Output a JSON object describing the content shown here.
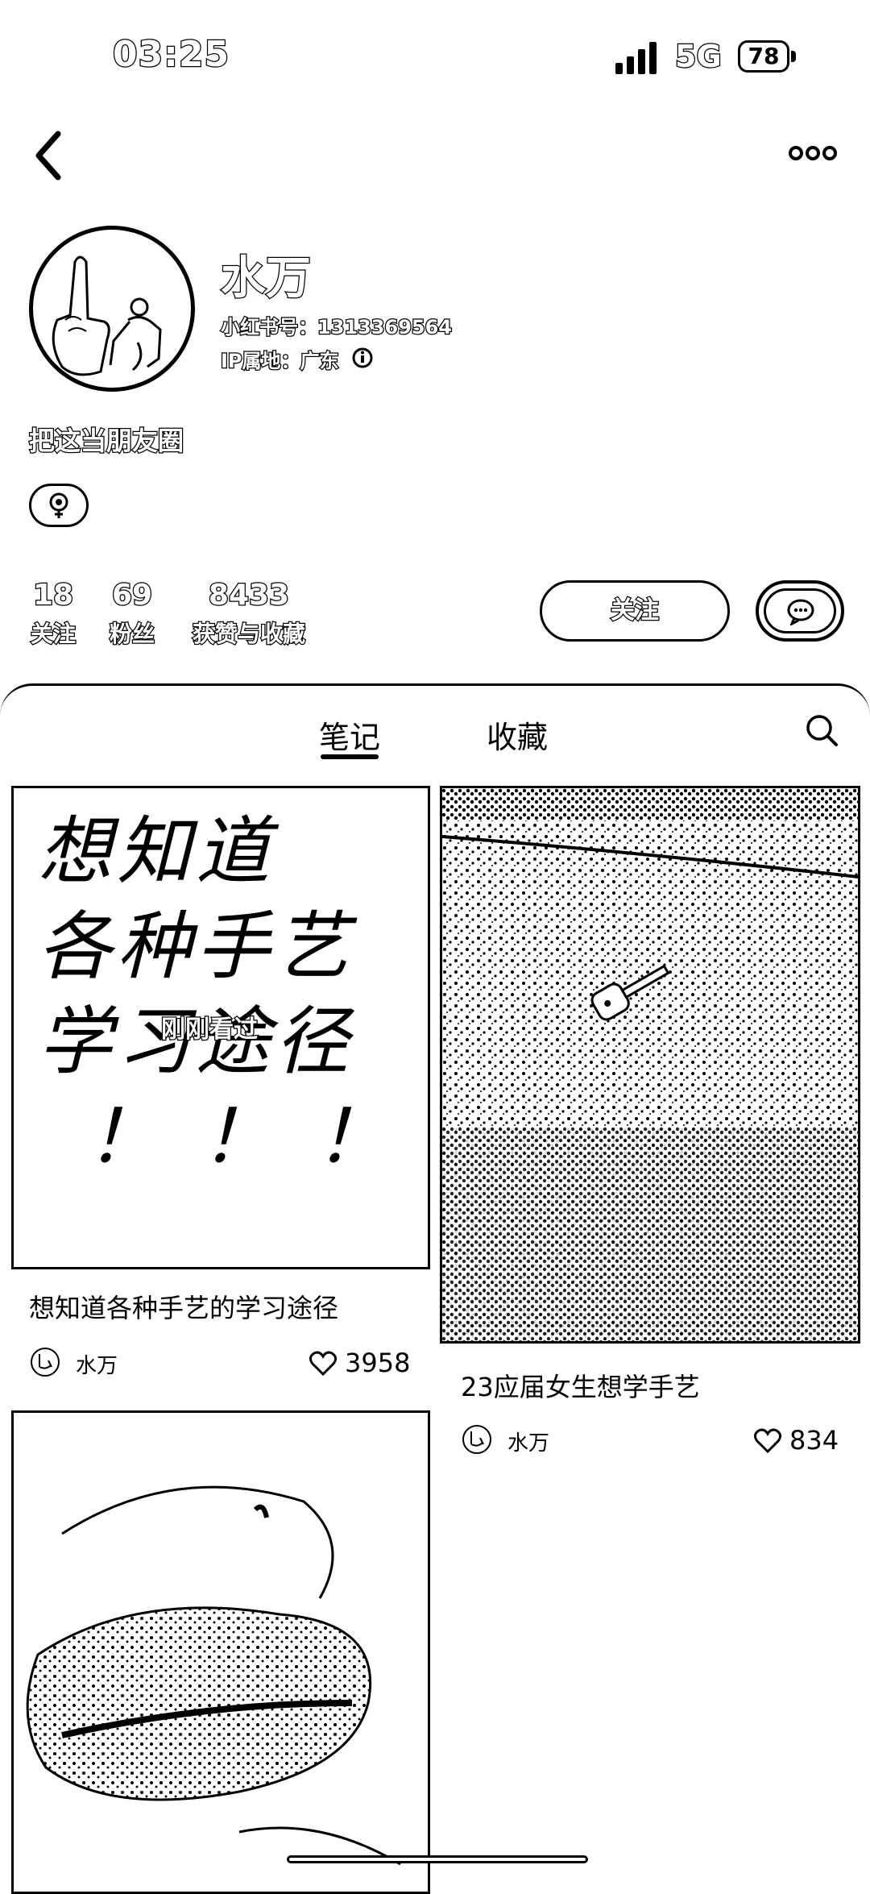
{
  "status_bar": {
    "time": "03:25",
    "network": "5G",
    "battery": "78"
  },
  "profile": {
    "name": "水万",
    "red_id": "小红书号：1313369564",
    "ip_location": "IP属地：广东",
    "bio": "把这当朋友圈"
  },
  "stats": [
    {
      "value": "18",
      "label": "关注"
    },
    {
      "value": "69",
      "label": "粉丝"
    },
    {
      "value": "8433",
      "label": "获赞与收藏"
    }
  ],
  "actions": {
    "follow_label": "关注"
  },
  "tabs": {
    "notes": "笔记",
    "favorites": "收藏"
  },
  "notes": [
    {
      "title": "想知道各种手艺的学习途径",
      "author": "水万",
      "likes": "3958",
      "overlay_tag": "刚刚看过",
      "image_text": [
        "想知道",
        "各种手艺",
        "学习途径",
        "！！！"
      ]
    },
    {
      "title": "23应届女生想学手艺",
      "author": "水万",
      "likes": "834"
    },
    {
      "title": "",
      "author": "",
      "likes": ""
    }
  ],
  "icons": {
    "back": "chevron-left-icon",
    "more": "more-dots-icon",
    "info": "info-icon",
    "gender": "female-icon",
    "chat": "chat-bubble-icon",
    "search": "search-icon",
    "like": "heart-icon"
  }
}
